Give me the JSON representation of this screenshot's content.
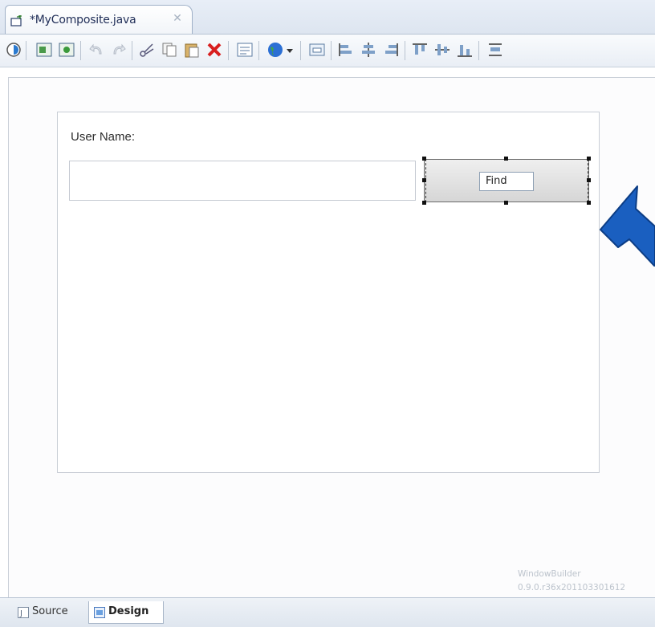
{
  "editor": {
    "tab_title": "*MyComposite.java",
    "tab_close_icon": "close-icon"
  },
  "toolbar": {
    "icons": [
      "test-gui-icon",
      "show-source-icon",
      "show-design-icon",
      "undo-icon",
      "redo-icon",
      "cut-icon",
      "copy-icon",
      "paste-icon",
      "delete-icon",
      "properties-icon",
      "globe-icon",
      "dropdown-arrow-icon",
      "css-icon",
      "align-left-icon",
      "align-center-icon",
      "align-right-icon",
      "align-top-icon",
      "align-middle-icon",
      "align-bottom-icon",
      "distribute-icon"
    ]
  },
  "form": {
    "user_name_label": "User Name:",
    "user_name_value": "",
    "find_button_label": "Find"
  },
  "watermark": {
    "line1": "WindowBuilder",
    "line2": "0.9.0.r36x201103301612"
  },
  "bottom_tabs": {
    "source": "Source",
    "design": "Design"
  },
  "colors": {
    "arrow": "#1a5fc0",
    "background": "#dfe7f2"
  }
}
